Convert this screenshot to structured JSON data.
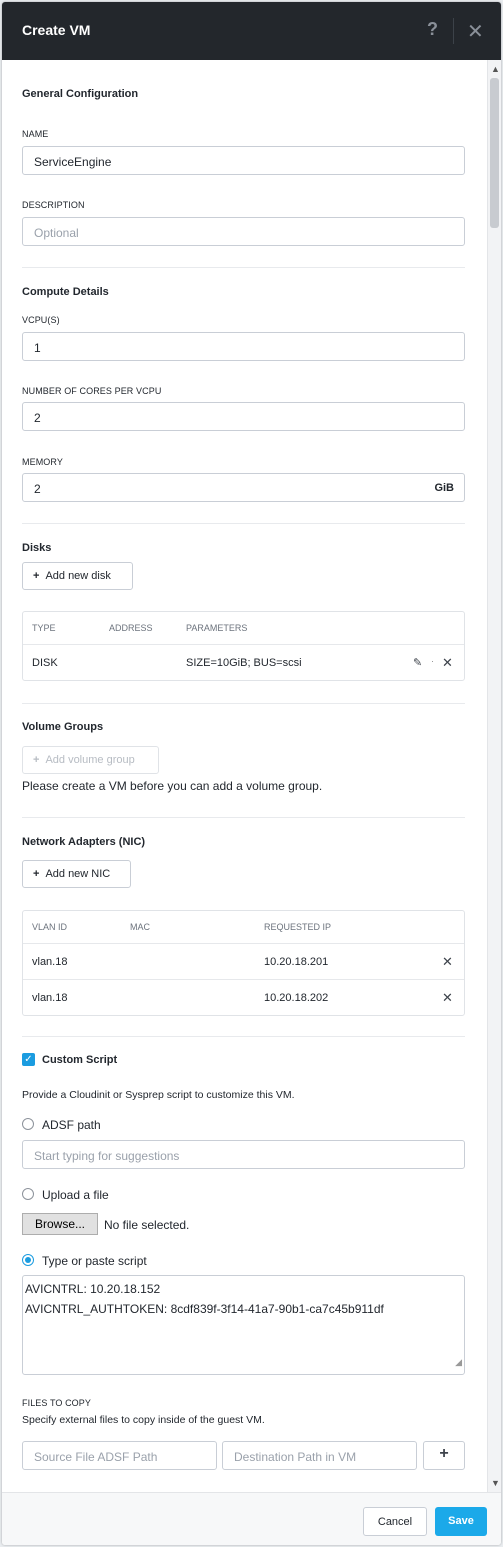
{
  "header": {
    "title": "Create VM",
    "help_glyph": "?",
    "close_glyph": "✕"
  },
  "general": {
    "section_title": "General Configuration",
    "name_label": "NAME",
    "name_value": "ServiceEngine",
    "description_label": "DESCRIPTION",
    "description_placeholder": "Optional"
  },
  "compute": {
    "section_title": "Compute Details",
    "vcpu_label": "VCPU(S)",
    "vcpu_value": "1",
    "cores_label": "NUMBER OF CORES PER VCPU",
    "cores_value": "2",
    "memory_label": "MEMORY",
    "memory_value": "2",
    "memory_unit": "GiB"
  },
  "disks": {
    "section_title": "Disks",
    "add_button": "Add new disk",
    "columns": [
      "TYPE",
      "ADDRESS",
      "PARAMETERS"
    ],
    "rows": [
      {
        "type": "DISK",
        "address": "",
        "parameters": "SIZE=10GiB; BUS=scsi"
      }
    ]
  },
  "volume_groups": {
    "section_title": "Volume Groups",
    "add_button": "Add volume group",
    "note": "Please create a VM before you can add a volume group."
  },
  "nics": {
    "section_title": "Network Adapters (NIC)",
    "add_button": "Add new NIC",
    "columns": [
      "VLAN ID",
      "MAC",
      "REQUESTED IP"
    ],
    "rows": [
      {
        "vlan": "vlan.18",
        "mac": "",
        "ip": "10.20.18.201"
      },
      {
        "vlan": "vlan.18",
        "mac": "",
        "ip": "10.20.18.202"
      }
    ]
  },
  "custom_script": {
    "checkbox_label": "Custom Script",
    "checked": true,
    "description": "Provide a Cloudinit or Sysprep script to customize this VM.",
    "option_adsf": "ADSF path",
    "adsf_placeholder": "Start typing for suggestions",
    "option_upload": "Upload a file",
    "browse_label": "Browse...",
    "no_file": "No file selected.",
    "option_type": "Type or paste script",
    "selected_option": "Type or paste script",
    "script_lines": [
      "AVICNTRL: 10.20.18.152",
      "AVICNTRL_AUTHTOKEN: 8cdf839f-3f14-41a7-90b1-ca7c45b911df"
    ]
  },
  "files_to_copy": {
    "label": "FILES TO COPY",
    "description": "Specify external files to copy inside of the guest VM.",
    "source_placeholder": "Source File ADSF Path",
    "destination_placeholder": "Destination Path in VM",
    "add_glyph": "+"
  },
  "footer": {
    "cancel_label": "Cancel",
    "save_label": "Save"
  },
  "colors": {
    "header_bg": "#23272c",
    "accent": "#1ba9e9"
  }
}
